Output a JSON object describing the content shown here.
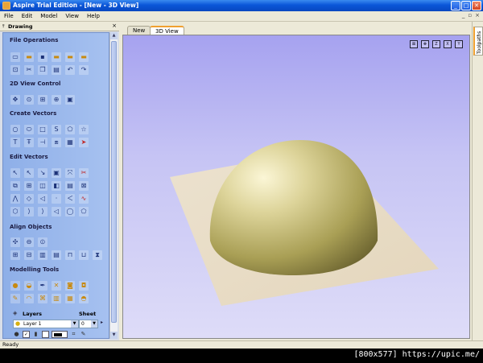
{
  "window": {
    "title": "Aspire Trial Edition - [New - 3D View]"
  },
  "menu": [
    "File",
    "Edit",
    "Model",
    "View",
    "Help"
  ],
  "mdi_controls": [
    "_",
    "▫",
    "×"
  ],
  "panel": {
    "title": "Drawing",
    "sections": {
      "file_operations": "File Operations",
      "view_control": "2D View Control",
      "create_vectors": "Create Vectors",
      "edit_vectors": "Edit Vectors",
      "align_objects": "Align Objects",
      "modelling_tools": "Modelling Tools"
    },
    "layers_label": "Layers",
    "sheet_label": "Sheet",
    "layer_value": "Layer 1",
    "sheet_value": "0"
  },
  "tabs": [
    "New",
    "3D View"
  ],
  "right_tab": "Toolpaths",
  "status": "Ready",
  "watermark": "[800x577] https://upic.me/",
  "colors": {
    "viewport_top": "#a6a2f0",
    "dome": "#c8be78",
    "plane": "#e8dcc4",
    "panel_bg": "#9bb9ee"
  }
}
